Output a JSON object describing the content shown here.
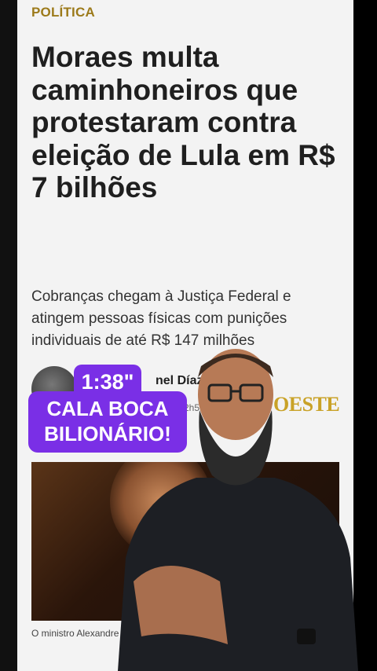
{
  "article": {
    "section": "POLÍTICA",
    "headline": "Moraes multa caminhoneiros que protestaram contra eleição de Lula em R$ 7 bilhões",
    "subhead": "Cobranças chegam à Justiça Federal e atingem pessoas físicas com punições individuais de até R$ 147 milhões",
    "author_name": "nel Díaz",
    "time": "2h5",
    "brand": "OESTE",
    "photo_caption": "O ministro Alexandre de M (STF) | Foto: Fabio Rodrigu"
  },
  "overlay": {
    "timer": "1:38\"",
    "callout": "CALA BOCA BILIONÁRIO!"
  },
  "colors": {
    "section": "#9c7a1a",
    "brand": "#c9a227",
    "callout_bg": "#7a2fe6",
    "article_bg": "#f3f3f3"
  },
  "icons": {
    "avatar": "author-avatar",
    "presenter": "presenter-figure"
  }
}
